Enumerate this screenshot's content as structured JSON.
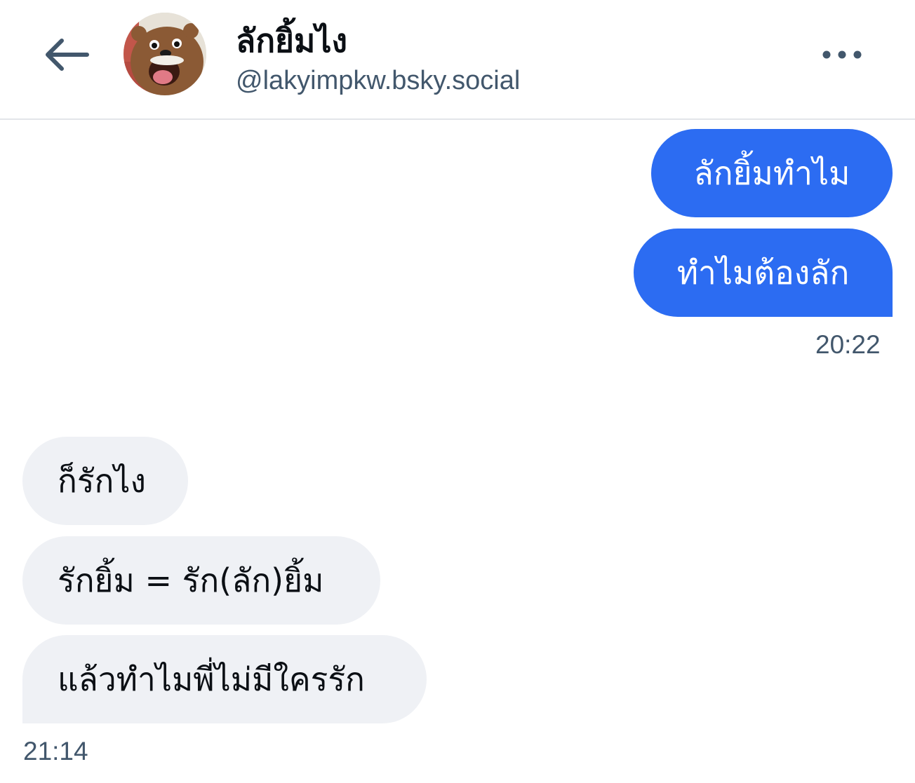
{
  "header": {
    "display_name": "ลักยิ้มไง",
    "handle": "@lakyimpkw.bsky.social",
    "back_icon": "arrow-left-icon",
    "more_icon": "ellipsis-horizontal-icon",
    "avatar_icon": "bear-avatar"
  },
  "messages": {
    "sent": [
      {
        "text": "ลักยิ้มทำไม"
      },
      {
        "text": "ทำไมต้องลัก"
      }
    ],
    "sent_time": "20:22",
    "received": [
      {
        "text": "ก็รักไง"
      },
      {
        "text": "รักยิ้ม = รัก(ลัก)ยิ้ม"
      },
      {
        "text": "แล้วทำไมพี่ไม่มีใครรัก"
      }
    ],
    "received_time": "21:14"
  },
  "colors": {
    "sent_bubble": "#2c6cf2",
    "received_bubble": "#eff1f5",
    "secondary_text": "#42576c",
    "primary_text": "#0b0f14"
  }
}
